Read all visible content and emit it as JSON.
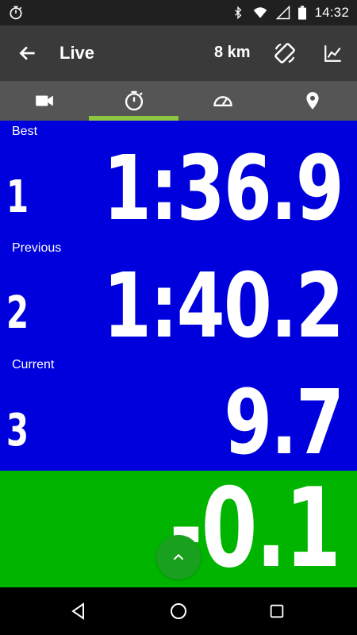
{
  "status_bar": {
    "time": "14:32",
    "icons": [
      "stopwatch-icon",
      "bluetooth-icon",
      "wifi-icon",
      "signal-icon",
      "battery-icon"
    ]
  },
  "app_bar": {
    "title": "Live",
    "distance": "8 km",
    "icons": [
      "back-arrow-icon",
      "screen-rotation-icon",
      "line-chart-icon"
    ]
  },
  "tabs": [
    {
      "icon": "video-camera-icon",
      "selected": false
    },
    {
      "icon": "stopwatch-icon",
      "selected": true
    },
    {
      "icon": "speedometer-icon",
      "selected": false
    },
    {
      "icon": "location-pin-icon",
      "selected": false
    }
  ],
  "rows": [
    {
      "caption": "Best",
      "number": "1",
      "value": "1:36.9"
    },
    {
      "caption": "Previous",
      "number": "2",
      "value": "1:40.2"
    },
    {
      "caption": "Current",
      "number": "3",
      "value": "9.7"
    }
  ],
  "delta": {
    "value": "-0.1"
  },
  "colors": {
    "blue_panel": "#0000dc",
    "green_panel": "#00b400",
    "tab_indicator": "#8dc63f",
    "app_bar": "#3a3a3a",
    "tab_bar": "#555555"
  },
  "nav_bar": {
    "icons": [
      "back-triangle-icon",
      "home-circle-icon",
      "recents-square-icon"
    ]
  }
}
